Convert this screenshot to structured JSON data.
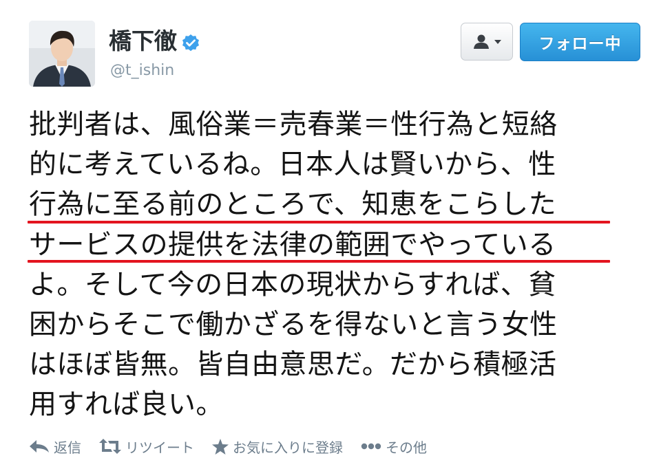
{
  "user": {
    "name": "橋下徹",
    "screen_name": "@t_ishin",
    "verified": true,
    "follow_button_label": "フォロー中",
    "dropdown_icon": "user-icon"
  },
  "tweet": {
    "lines": [
      "批判者は、風俗業＝売春業＝性行為と短絡",
      "的に考えているね。日本人は賢いから、性",
      "行為に至る前のところで、知恵をこらした",
      "サービスの提供を法律の範囲でやっている",
      "よ。そして今の日本の現状からすれば、貧",
      "困からそこで働かざるを得ないと言う女性",
      "はほぼ皆無。皆自由意思だ。だから積極活",
      "用すれば良い。"
    ],
    "underline_color": "#e3141f"
  },
  "actions": [
    {
      "icon": "reply-icon",
      "label": "返信"
    },
    {
      "icon": "retweet-icon",
      "label": "リツイート"
    },
    {
      "icon": "star-icon",
      "label": "お気に入りに登録"
    },
    {
      "icon": "more-icon",
      "label": "その他"
    }
  ],
  "colors": {
    "follow_button": "#2790d6",
    "verified": "#3ea1ec",
    "action_text": "#6c7d8c"
  }
}
